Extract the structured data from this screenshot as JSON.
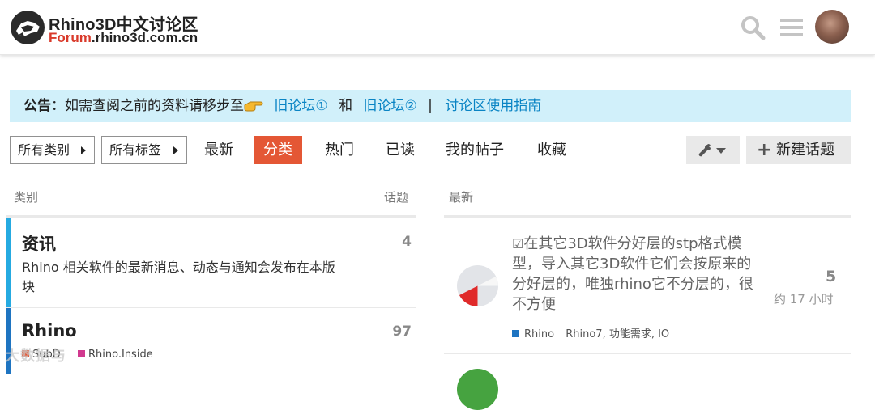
{
  "header": {
    "site_title": "Rhino3D中文讨论区",
    "site_sub_prefix": "Forum",
    "site_sub_rest": ".rhino3d.com.cn",
    "icons": [
      "search-icon",
      "menu-icon",
      "user-avatar"
    ]
  },
  "notice": {
    "label": "公告",
    "text": "：如需查阅之前的资料请移步至",
    "link1": "旧论坛①",
    "and": "和",
    "link2": "旧论坛②",
    "sep": "|",
    "link3": "讨论区使用指南"
  },
  "nav": {
    "all_categories": "所有类别",
    "all_tags": "所有标签",
    "tabs": [
      "最新",
      "分类",
      "热门",
      "已读",
      "我的帖子",
      "收藏"
    ],
    "active_tab": "分类",
    "new_topic": "新建话题"
  },
  "categories_column": {
    "heading": "类别",
    "topics_heading": "话题",
    "items": [
      {
        "name": "资讯",
        "description": "Rhino 相关软件的最新消息、动态与通知会发布在本版块",
        "count": "4",
        "color": "#25aae1"
      },
      {
        "name": "Rhino",
        "description": "",
        "count": "97",
        "color": "#1e74c1",
        "subcategories": [
          {
            "name": "SubD",
            "color": "#e45735"
          },
          {
            "name": "Rhino.Inside",
            "color": "#d1398f"
          }
        ]
      }
    ]
  },
  "latest_column": {
    "heading": "最新",
    "topics": [
      {
        "title": "在其它3D软件分好层的stp格式模型，导入其它3D软件它们会按原来的分好层的，唯独rhino它不分层的，很不方便",
        "category": "Rhino",
        "tags": "Rhino7, 功能需求, IO",
        "replies": "5",
        "time": "约 17 小时"
      }
    ]
  },
  "watermark": "大数据与"
}
